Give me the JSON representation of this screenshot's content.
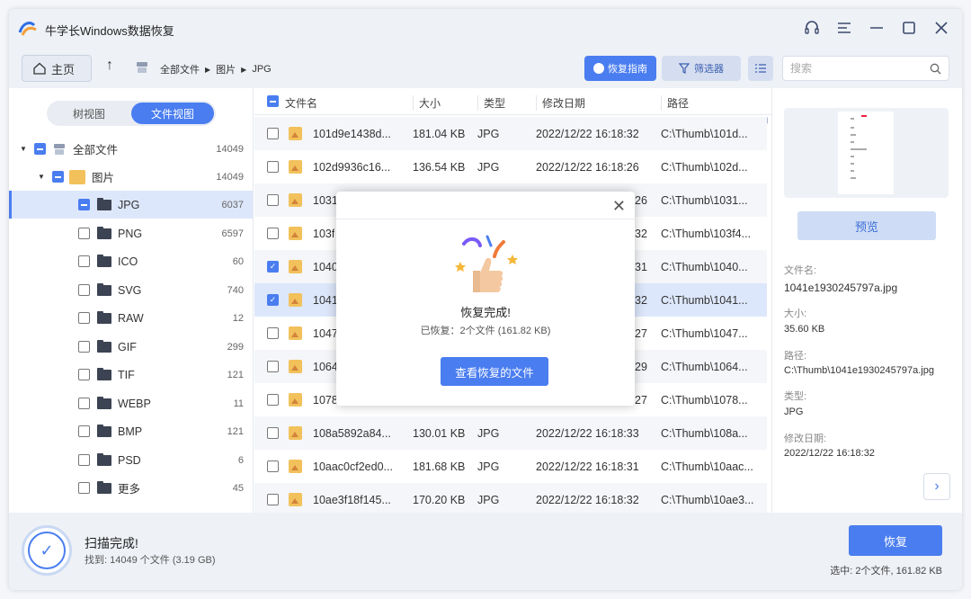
{
  "app": {
    "title": "牛学长Windows数据恢复"
  },
  "toolbar": {
    "home_label": "主页",
    "breadcrumb": [
      "全部文件",
      "图片",
      "JPG"
    ],
    "guide_label": "恢复指南",
    "filter_label": "筛选器",
    "search_placeholder": "搜索"
  },
  "view_toggle": {
    "tree_label": "树视图",
    "file_label": "文件视图"
  },
  "tree": [
    {
      "label": "全部文件",
      "count": "14049"
    },
    {
      "label": "图片",
      "count": "14049"
    },
    {
      "label": "JPG",
      "count": "6037"
    },
    {
      "label": "PNG",
      "count": "6597"
    },
    {
      "label": "ICO",
      "count": "60"
    },
    {
      "label": "SVG",
      "count": "740"
    },
    {
      "label": "RAW",
      "count": "12"
    },
    {
      "label": "GIF",
      "count": "299"
    },
    {
      "label": "TIF",
      "count": "121"
    },
    {
      "label": "WEBP",
      "count": "11"
    },
    {
      "label": "BMP",
      "count": "121"
    },
    {
      "label": "PSD",
      "count": "6"
    },
    {
      "label": "更多",
      "count": "45"
    }
  ],
  "list": {
    "headers": {
      "name": "文件名",
      "size": "大小",
      "type": "类型",
      "date": "修改日期",
      "path": "路径"
    },
    "rows": [
      {
        "name": "101d9e1438d...",
        "size": "181.04 KB",
        "type": "JPG",
        "date": "2022/12/22 16:18:32",
        "path": "C:\\Thumb\\101d..."
      },
      {
        "name": "102d9936c16...",
        "size": "136.54 KB",
        "type": "JPG",
        "date": "2022/12/22 16:18:26",
        "path": "C:\\Thumb\\102d..."
      },
      {
        "name": "1031",
        "size": "",
        "type": "",
        "date": "26",
        "path": "C:\\Thumb\\1031..."
      },
      {
        "name": "103f",
        "size": "",
        "type": "",
        "date": "32",
        "path": "C:\\Thumb\\103f4..."
      },
      {
        "name": "1040",
        "size": "",
        "type": "",
        "date": "31",
        "path": "C:\\Thumb\\1040..."
      },
      {
        "name": "1041",
        "size": "",
        "type": "",
        "date": "32",
        "path": "C:\\Thumb\\1041..."
      },
      {
        "name": "1047",
        "size": "",
        "type": "",
        "date": "27",
        "path": "C:\\Thumb\\1047..."
      },
      {
        "name": "1064",
        "size": "",
        "type": "",
        "date": "29",
        "path": "C:\\Thumb\\1064..."
      },
      {
        "name": "1078",
        "size": "",
        "type": "",
        "date": "27",
        "path": "C:\\Thumb\\1078..."
      },
      {
        "name": "108a5892a84...",
        "size": "130.01 KB",
        "type": "JPG",
        "date": "2022/12/22 16:18:33",
        "path": "C:\\Thumb\\108a..."
      },
      {
        "name": "10aac0cf2ed0...",
        "size": "181.68 KB",
        "type": "JPG",
        "date": "2022/12/22 16:18:31",
        "path": "C:\\Thumb\\10aac..."
      },
      {
        "name": "10ae3f18f145...",
        "size": "170.20 KB",
        "type": "JPG",
        "date": "2022/12/22 16:18:32",
        "path": "C:\\Thumb\\10ae3..."
      }
    ]
  },
  "preview": {
    "button": "预览",
    "filename_label": "文件名:",
    "filename": "1041e1930245797a.jpg",
    "size_label": "大小:",
    "size": "35.60 KB",
    "path_label": "路径:",
    "path": "C:\\Thumb\\1041e1930245797a.jpg",
    "type_label": "类型:",
    "type": "JPG",
    "date_label": "修改日期:",
    "date": "2022/12/22 16:18:32"
  },
  "footer": {
    "scan_title": "扫描完成!",
    "scan_sub": "找到: 14049 个文件 (3.19 GB)",
    "recover_label": "恢复",
    "selection_info": "选中: 2个文件, 161.82 KB"
  },
  "dialog": {
    "title": "恢复完成!",
    "subtitle": "已恢复：2个文件 (161.82 KB)",
    "button": "查看恢复的文件"
  },
  "colors": {
    "accent": "#4a7df0",
    "selected_row": "#dde7fb"
  }
}
